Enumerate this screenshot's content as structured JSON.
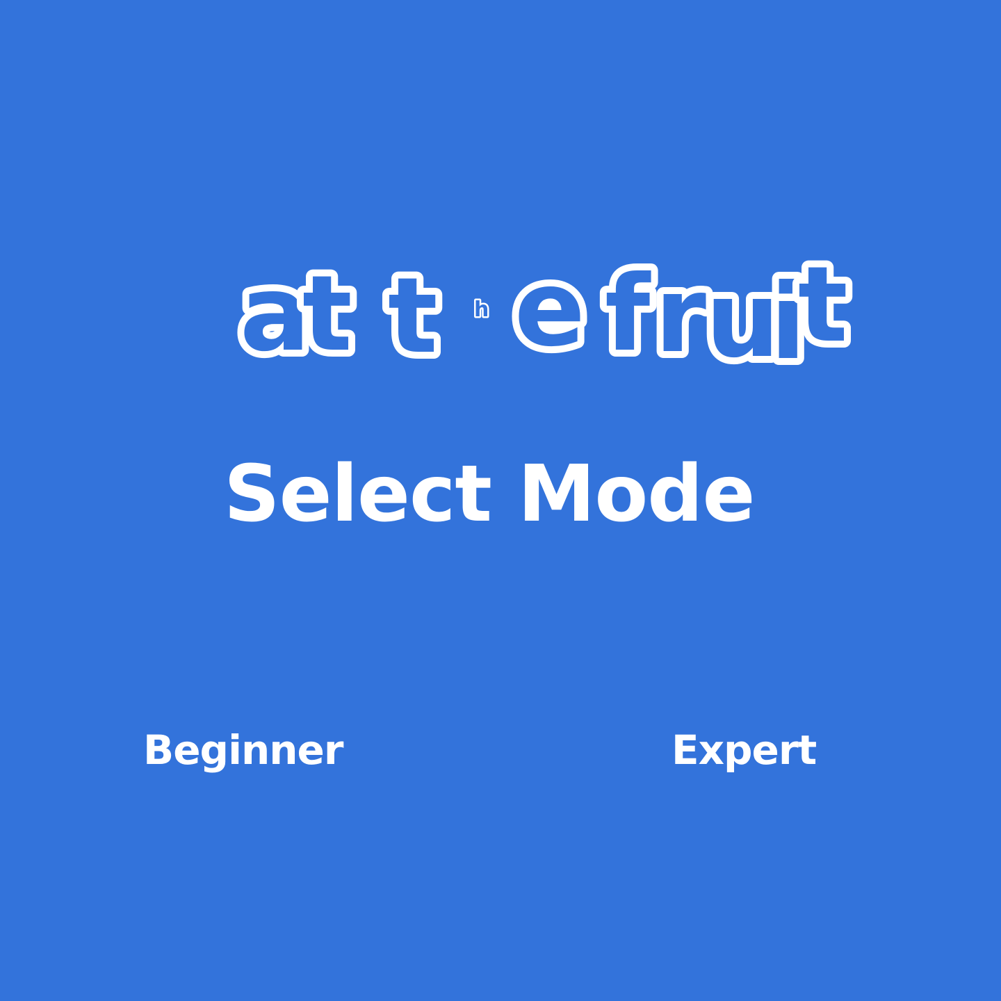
{
  "logo": {
    "letters": [
      "a",
      "t",
      "t",
      "h",
      "e",
      "f",
      "r",
      "u",
      "i",
      "t"
    ]
  },
  "screen": {
    "title": "Select Mode"
  },
  "modes": {
    "beginner_label": "Beginner",
    "expert_label": "Expert"
  },
  "colors": {
    "background": "#3373DB",
    "text": "#FFFFFF"
  }
}
